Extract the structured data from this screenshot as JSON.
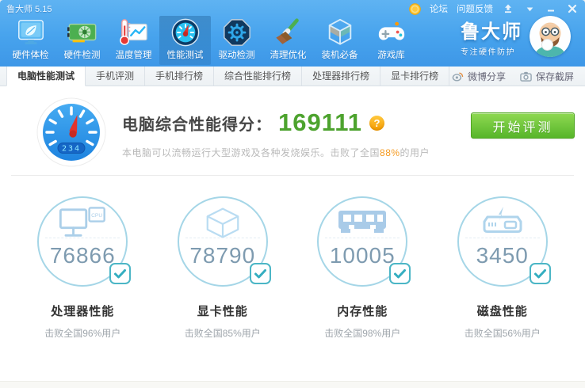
{
  "window": {
    "title": "鲁大师 5.15",
    "links": [
      {
        "label": "论坛"
      },
      {
        "label": "问题反馈"
      }
    ]
  },
  "toolbar": {
    "items": [
      {
        "label": "硬件体检"
      },
      {
        "label": "硬件检测"
      },
      {
        "label": "温度管理"
      },
      {
        "label": "性能测试"
      },
      {
        "label": "驱动检测"
      },
      {
        "label": "清理优化"
      },
      {
        "label": "装机必备"
      },
      {
        "label": "游戏库"
      }
    ]
  },
  "brand": {
    "name": "鲁大师",
    "tagline": "专注硬件防护"
  },
  "tabs": {
    "items": [
      {
        "label": "电脑性能测试"
      },
      {
        "label": "手机评测"
      },
      {
        "label": "手机排行榜"
      },
      {
        "label": "综合性能排行榜"
      },
      {
        "label": "处理器排行榜"
      },
      {
        "label": "显卡排行榜"
      }
    ],
    "actions": [
      {
        "label": "微博分享"
      },
      {
        "label": "保存截屏"
      }
    ]
  },
  "score_header": {
    "title": "电脑综合性能得分：",
    "score": "169111",
    "help_label": "?",
    "gauge_badge": "234",
    "subtitle_prefix": "本电脑可以流畅运行大型游戏及各种发烧娱乐。击败了全国",
    "subtitle_highlight": "88%",
    "subtitle_suffix": "的用户",
    "button_label": "开始评测"
  },
  "cards": [
    {
      "score": "76866",
      "label": "处理器性能",
      "beat": "击败全国96%用户",
      "icon_label": "CPU"
    },
    {
      "score": "78790",
      "label": "显卡性能",
      "beat": "击败全国85%用户"
    },
    {
      "score": "10005",
      "label": "内存性能",
      "beat": "击败全国98%用户"
    },
    {
      "score": "3450",
      "label": "磁盘性能",
      "beat": "击败全国56%用户"
    }
  ],
  "colors": {
    "chrome_blue": "#47A3ED",
    "score_green": "#4DA32E",
    "button_green": "#57B52A",
    "highlight_orange": "#F59B22",
    "circle_blue": "#A5D6E7",
    "check_teal": "#4BB6C6"
  }
}
